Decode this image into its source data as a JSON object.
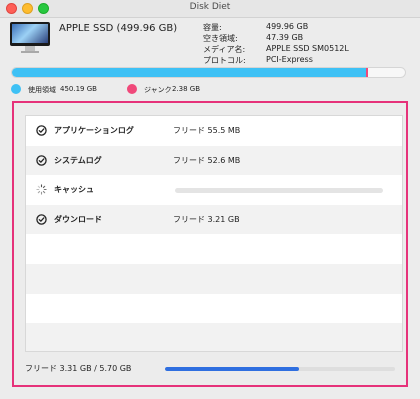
{
  "window": {
    "title": "Disk Diet"
  },
  "disk": {
    "name": "APPLE SSD (499.96 GB)",
    "info": [
      {
        "label": "容量:",
        "value": "499.96 GB"
      },
      {
        "label": "空き領域:",
        "value": "47.39 GB"
      },
      {
        "label": "メディア名:",
        "value": "APPLE SSD SM0512L"
      },
      {
        "label": "プロトコル:",
        "value": "PCI-Express"
      }
    ]
  },
  "usage": {
    "used_fraction": 0.9004,
    "junk_fraction": 0.0048,
    "used_color": "#3ec1f5",
    "junk_color": "#f0497a"
  },
  "legend": {
    "used_label": "使用領域",
    "used_value": "450.19 GB",
    "junk_label": "ジャンク",
    "junk_value": "2.38 GB"
  },
  "items": [
    {
      "name": "アプリケーションログ",
      "free": "フリード 55.5 MB",
      "status": "done",
      "icon": "check-circle-icon"
    },
    {
      "name": "システムログ",
      "free": "フリード 52.6 MB",
      "status": "done",
      "icon": "check-circle-icon"
    },
    {
      "name": "キャッシュ",
      "free": "",
      "status": "in-progress",
      "icon": "spinner-icon"
    },
    {
      "name": "ダウンロード",
      "free": "フリード 3.21 GB",
      "status": "done",
      "icon": "check-circle-icon"
    }
  ],
  "footer": {
    "text": "フリード 3.31 GB / 5.70 GB",
    "progress_fraction": 0.581,
    "progress_color": "#2f6fe0"
  },
  "highlight_color": "#e6327a"
}
